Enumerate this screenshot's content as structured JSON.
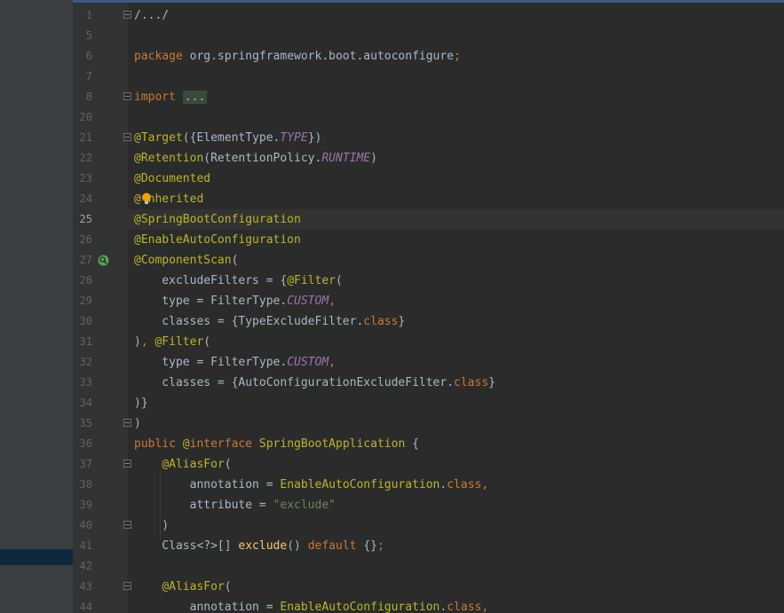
{
  "editor": {
    "current_line": "25",
    "lines": [
      {
        "n": "1",
        "fold": true,
        "tokens": [
          {
            "t": "/.../",
            "c": "plain"
          }
        ]
      },
      {
        "n": "5",
        "tokens": []
      },
      {
        "n": "6",
        "tokens": [
          {
            "t": "package ",
            "c": "kw"
          },
          {
            "t": "org.springframework.boot.autoconfigure",
            "c": "plain"
          },
          {
            "t": ";",
            "c": "kw"
          }
        ]
      },
      {
        "n": "7",
        "tokens": []
      },
      {
        "n": "8",
        "fold": true,
        "tokens": [
          {
            "t": "import ",
            "c": "kw"
          },
          {
            "t": "...",
            "c": "fold-box"
          }
        ]
      },
      {
        "n": "20",
        "tokens": []
      },
      {
        "n": "21",
        "fold": true,
        "tokens": [
          {
            "t": "@Target",
            "c": "ann"
          },
          {
            "t": "({ElementType.",
            "c": "plain"
          },
          {
            "t": "TYPE",
            "c": "cst"
          },
          {
            "t": "})",
            "c": "plain"
          }
        ]
      },
      {
        "n": "22",
        "tokens": [
          {
            "t": "@Retention",
            "c": "ann"
          },
          {
            "t": "(RetentionPolicy.",
            "c": "plain"
          },
          {
            "t": "RUNTIME",
            "c": "cst"
          },
          {
            "t": ")",
            "c": "plain"
          }
        ]
      },
      {
        "n": "23",
        "tokens": [
          {
            "t": "@Documented",
            "c": "ann"
          }
        ]
      },
      {
        "n": "24",
        "bulb": true,
        "tokens": [
          {
            "t": "@",
            "c": "ann"
          },
          {
            "t": " ",
            "c": "plain"
          },
          {
            "t": "nherited",
            "c": "ann"
          }
        ]
      },
      {
        "n": "25",
        "tokens": [
          {
            "t": "@SpringBootConfiguration",
            "c": "ann"
          }
        ]
      },
      {
        "n": "26",
        "tokens": [
          {
            "t": "@EnableAutoConfiguration",
            "c": "ann"
          }
        ]
      },
      {
        "n": "27",
        "scan": true,
        "tokens": [
          {
            "t": "@ComponentScan",
            "c": "ann"
          },
          {
            "t": "(",
            "c": "plain"
          }
        ]
      },
      {
        "n": "28",
        "tokens": [
          {
            "t": "    excludeFilters = {",
            "c": "plain"
          },
          {
            "t": "@Filter",
            "c": "ann"
          },
          {
            "t": "(",
            "c": "plain"
          }
        ]
      },
      {
        "n": "29",
        "tokens": [
          {
            "t": "    type = FilterType.",
            "c": "plain"
          },
          {
            "t": "CUSTOM",
            "c": "cst"
          },
          {
            "t": ",",
            "c": "kw"
          }
        ]
      },
      {
        "n": "30",
        "tokens": [
          {
            "t": "    classes = {TypeExcludeFilter.",
            "c": "plain"
          },
          {
            "t": "class",
            "c": "kw"
          },
          {
            "t": "}",
            "c": "plain"
          }
        ]
      },
      {
        "n": "31",
        "tokens": [
          {
            "t": ")",
            "c": "plain"
          },
          {
            "t": ", ",
            "c": "kw"
          },
          {
            "t": "@Filter",
            "c": "ann"
          },
          {
            "t": "(",
            "c": "plain"
          }
        ]
      },
      {
        "n": "32",
        "tokens": [
          {
            "t": "    type = FilterType.",
            "c": "plain"
          },
          {
            "t": "CUSTOM",
            "c": "cst"
          },
          {
            "t": ",",
            "c": "kw"
          }
        ]
      },
      {
        "n": "33",
        "tokens": [
          {
            "t": "    classes = {AutoConfigurationExcludeFilter.",
            "c": "plain"
          },
          {
            "t": "class",
            "c": "kw"
          },
          {
            "t": "}",
            "c": "plain"
          }
        ]
      },
      {
        "n": "34",
        "tokens": [
          {
            "t": ")}",
            "c": "plain"
          }
        ]
      },
      {
        "n": "35",
        "fold": true,
        "tokens": [
          {
            "t": ")",
            "c": "plain"
          }
        ]
      },
      {
        "n": "36",
        "tokens": [
          {
            "t": "public ",
            "c": "kw"
          },
          {
            "t": "@",
            "c": "ann"
          },
          {
            "t": "interface ",
            "c": "kw"
          },
          {
            "t": "SpringBootApplication ",
            "c": "ann"
          },
          {
            "t": "{",
            "c": "plain"
          }
        ]
      },
      {
        "n": "37",
        "fold": true,
        "tokens": [
          {
            "t": "    ",
            "c": "plain"
          },
          {
            "t": "@AliasFor",
            "c": "ann"
          },
          {
            "t": "(",
            "c": "plain"
          }
        ]
      },
      {
        "n": "38",
        "tokens": [
          {
            "t": "        annotation = ",
            "c": "plain"
          },
          {
            "t": "EnableAutoConfiguration",
            "c": "ann"
          },
          {
            "t": ".",
            "c": "plain"
          },
          {
            "t": "class",
            "c": "kw"
          },
          {
            "t": ",",
            "c": "kw"
          }
        ]
      },
      {
        "n": "39",
        "tokens": [
          {
            "t": "        attribute = ",
            "c": "plain"
          },
          {
            "t": "\"exclude\"",
            "c": "str"
          }
        ]
      },
      {
        "n": "40",
        "fold": true,
        "tokens": [
          {
            "t": "    )",
            "c": "plain"
          }
        ]
      },
      {
        "n": "41",
        "tokens": [
          {
            "t": "    Class<?>[] ",
            "c": "plain"
          },
          {
            "t": "exclude",
            "c": "fn"
          },
          {
            "t": "() ",
            "c": "plain"
          },
          {
            "t": "default ",
            "c": "kw"
          },
          {
            "t": "{}",
            "c": "plain"
          },
          {
            "t": ";",
            "c": "kw"
          }
        ]
      },
      {
        "n": "42",
        "tokens": []
      },
      {
        "n": "43",
        "fold": true,
        "tokens": [
          {
            "t": "    ",
            "c": "plain"
          },
          {
            "t": "@AliasFor",
            "c": "ann"
          },
          {
            "t": "(",
            "c": "plain"
          }
        ]
      },
      {
        "n": "44",
        "tokens": [
          {
            "t": "        annotation = ",
            "c": "plain"
          },
          {
            "t": "EnableAutoConfiguration",
            "c": "ann"
          },
          {
            "t": ".",
            "c": "plain"
          },
          {
            "t": "class",
            "c": "kw"
          },
          {
            "t": ",",
            "c": "kw"
          }
        ]
      }
    ]
  }
}
